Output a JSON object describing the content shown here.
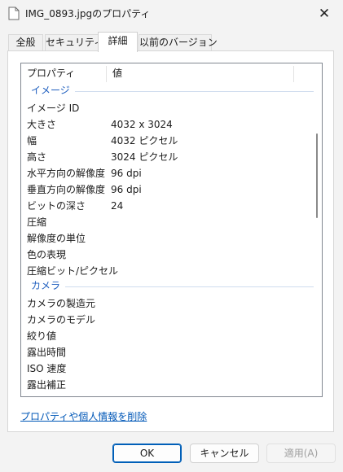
{
  "window": {
    "title": "IMG_0893.jpgのプロパティ",
    "close_glyph": "✕",
    "icon": "file-icon"
  },
  "tabs": [
    {
      "label": "全般",
      "active": false
    },
    {
      "label": "セキュリティ",
      "active": false
    },
    {
      "label": "詳細",
      "active": true
    },
    {
      "label": "以前のバージョン",
      "active": false
    }
  ],
  "listview": {
    "columns": [
      "プロパティ",
      "値"
    ],
    "groups": [
      {
        "label": "イメージ",
        "rows": [
          {
            "name": "イメージ ID",
            "value": ""
          },
          {
            "name": "大きさ",
            "value": "4032 x 3024"
          },
          {
            "name": "幅",
            "value": "4032 ピクセル"
          },
          {
            "name": "高さ",
            "value": "3024 ピクセル"
          },
          {
            "name": "水平方向の解像度",
            "value": "96 dpi"
          },
          {
            "name": "垂直方向の解像度",
            "value": "96 dpi"
          },
          {
            "name": "ビットの深さ",
            "value": "24"
          },
          {
            "name": "圧縮",
            "value": ""
          },
          {
            "name": "解像度の単位",
            "value": ""
          },
          {
            "name": "色の表現",
            "value": ""
          },
          {
            "name": "圧縮ビット/ピクセル",
            "value": ""
          }
        ]
      },
      {
        "label": "カメラ",
        "rows": [
          {
            "name": "カメラの製造元",
            "value": ""
          },
          {
            "name": "カメラのモデル",
            "value": ""
          },
          {
            "name": "絞り値",
            "value": ""
          },
          {
            "name": "露出時間",
            "value": ""
          },
          {
            "name": "ISO 速度",
            "value": ""
          },
          {
            "name": "露出補正",
            "value": ""
          }
        ]
      }
    ]
  },
  "remove_link": "プロパティや個人情報を削除",
  "buttons": {
    "ok": "OK",
    "cancel": "キャンセル",
    "apply": "適用(A)"
  },
  "colors": {
    "group_header": "#1f5fbf",
    "link": "#0057b7",
    "default_button_border": "#005fb8"
  }
}
